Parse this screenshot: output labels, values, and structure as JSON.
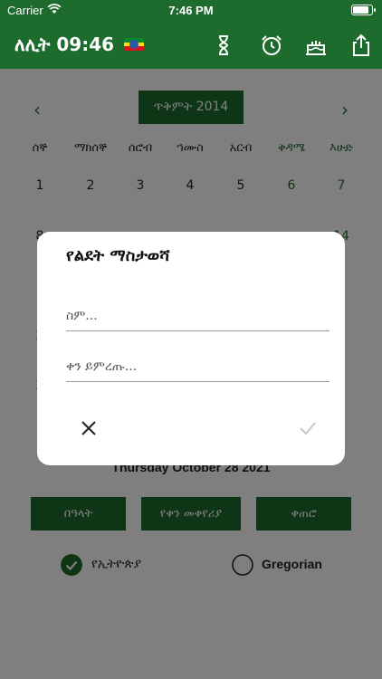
{
  "status": {
    "carrier": "Carrier",
    "time": "7:46 PM",
    "battery_level": 0.92
  },
  "appbar": {
    "title": "ለሊት 09:46",
    "icons": [
      "hourglass-icon",
      "alarm-clock-icon",
      "cake-icon",
      "share-icon"
    ]
  },
  "calendar": {
    "month_label": "ጥቅምት 2014",
    "weekdays": [
      "ሰኞ",
      "ማክሰኞ",
      "ሰሮብ",
      "ኀሙስ",
      "አርብ",
      "ቅዳሜ",
      "እሁድ"
    ],
    "visible_rows": [
      [
        "1",
        "2",
        "3",
        "4",
        "5",
        "6",
        "7"
      ],
      [
        "8",
        "",
        "",
        "",
        "",
        "",
        "14"
      ],
      [
        "1",
        "",
        "",
        "",
        "",
        "",
        "1"
      ],
      [
        "2",
        "",
        "",
        "",
        "",
        "",
        "8"
      ],
      [
        "2",
        "",
        "",
        "",
        "",
        "",
        ""
      ]
    ],
    "gregorian_date": "Thursday October 28 2021"
  },
  "actions": {
    "holidays": "በዓላት",
    "date_converter": "የቀን መቀየሪያ",
    "counter": "ቀጠሮ"
  },
  "calendar_mode": {
    "ethiopian_label": "የኢትዮጵያ",
    "gregorian_label": "Gregorian",
    "selected": "ethiopian"
  },
  "dialog": {
    "title": "የልደት ማስታወሻ",
    "name_placeholder": "ስም...",
    "date_placeholder": "ቀን ይምረጡ..."
  },
  "colors": {
    "primary": "#1e6b2e",
    "overlay": "rgba(0,0,0,0.5)"
  }
}
